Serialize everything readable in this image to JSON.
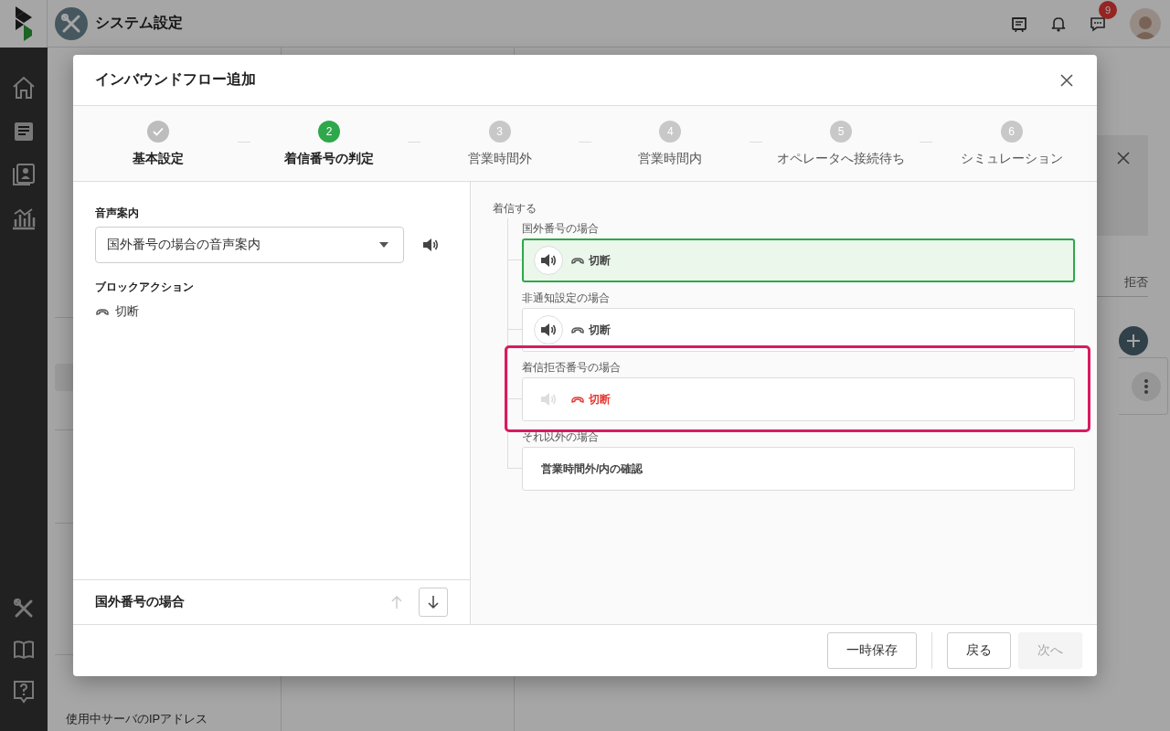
{
  "app_header": {
    "title": "システム設定",
    "notification_count": "9"
  },
  "settings_menu": {
    "items": [
      {
        "label": "使用中サーバのIPアドレス",
        "selected": false
      }
    ]
  },
  "background_panel": {
    "column_label": "拒否"
  },
  "dialog": {
    "title": "インバウンドフロー追加",
    "steps": [
      {
        "label": "基本設定",
        "completed": true,
        "selected": false
      },
      {
        "number": "2",
        "label": "着信番号の判定",
        "completed": false,
        "selected": true
      },
      {
        "number": "3",
        "label": "営業時間外",
        "completed": false,
        "selected": false
      },
      {
        "number": "4",
        "label": "営業時間内",
        "completed": false,
        "selected": false
      },
      {
        "number": "5",
        "label": "オペレータへ接続待ち",
        "completed": false,
        "selected": false
      },
      {
        "number": "6",
        "label": "シミュレーション",
        "completed": false,
        "selected": false
      }
    ],
    "voice_guidance": {
      "label": "音声案内",
      "value": "国外番号の場合の音声案内"
    },
    "block_action": {
      "label": "ブロックアクション",
      "value": "切断"
    },
    "footer_panel": {
      "title": "国外番号の場合",
      "move_up_disabled": true,
      "move_down_disabled": false
    },
    "flow": {
      "root": "着信する",
      "branches": [
        {
          "kind": "action",
          "label": "国外番号の場合",
          "selected": true,
          "highlighted": false,
          "audio_enabled": true,
          "action": "切断",
          "danger": false
        },
        {
          "kind": "action",
          "label": "非通知設定の場合",
          "selected": false,
          "highlighted": false,
          "audio_enabled": true,
          "action": "切断",
          "danger": false
        },
        {
          "kind": "action",
          "label": "着信拒否番号の場合",
          "selected": false,
          "highlighted": true,
          "audio_enabled": false,
          "action": "切断",
          "danger": true
        },
        {
          "kind": "link",
          "label": "それ以外の場合",
          "selected": false,
          "highlighted": false,
          "text": "営業時間外/内の確認"
        }
      ]
    },
    "buttons": [
      {
        "label": "一時保存",
        "disabled": false
      },
      {
        "label": "戻る",
        "disabled": false
      },
      {
        "label": "次へ",
        "disabled": true
      }
    ]
  }
}
